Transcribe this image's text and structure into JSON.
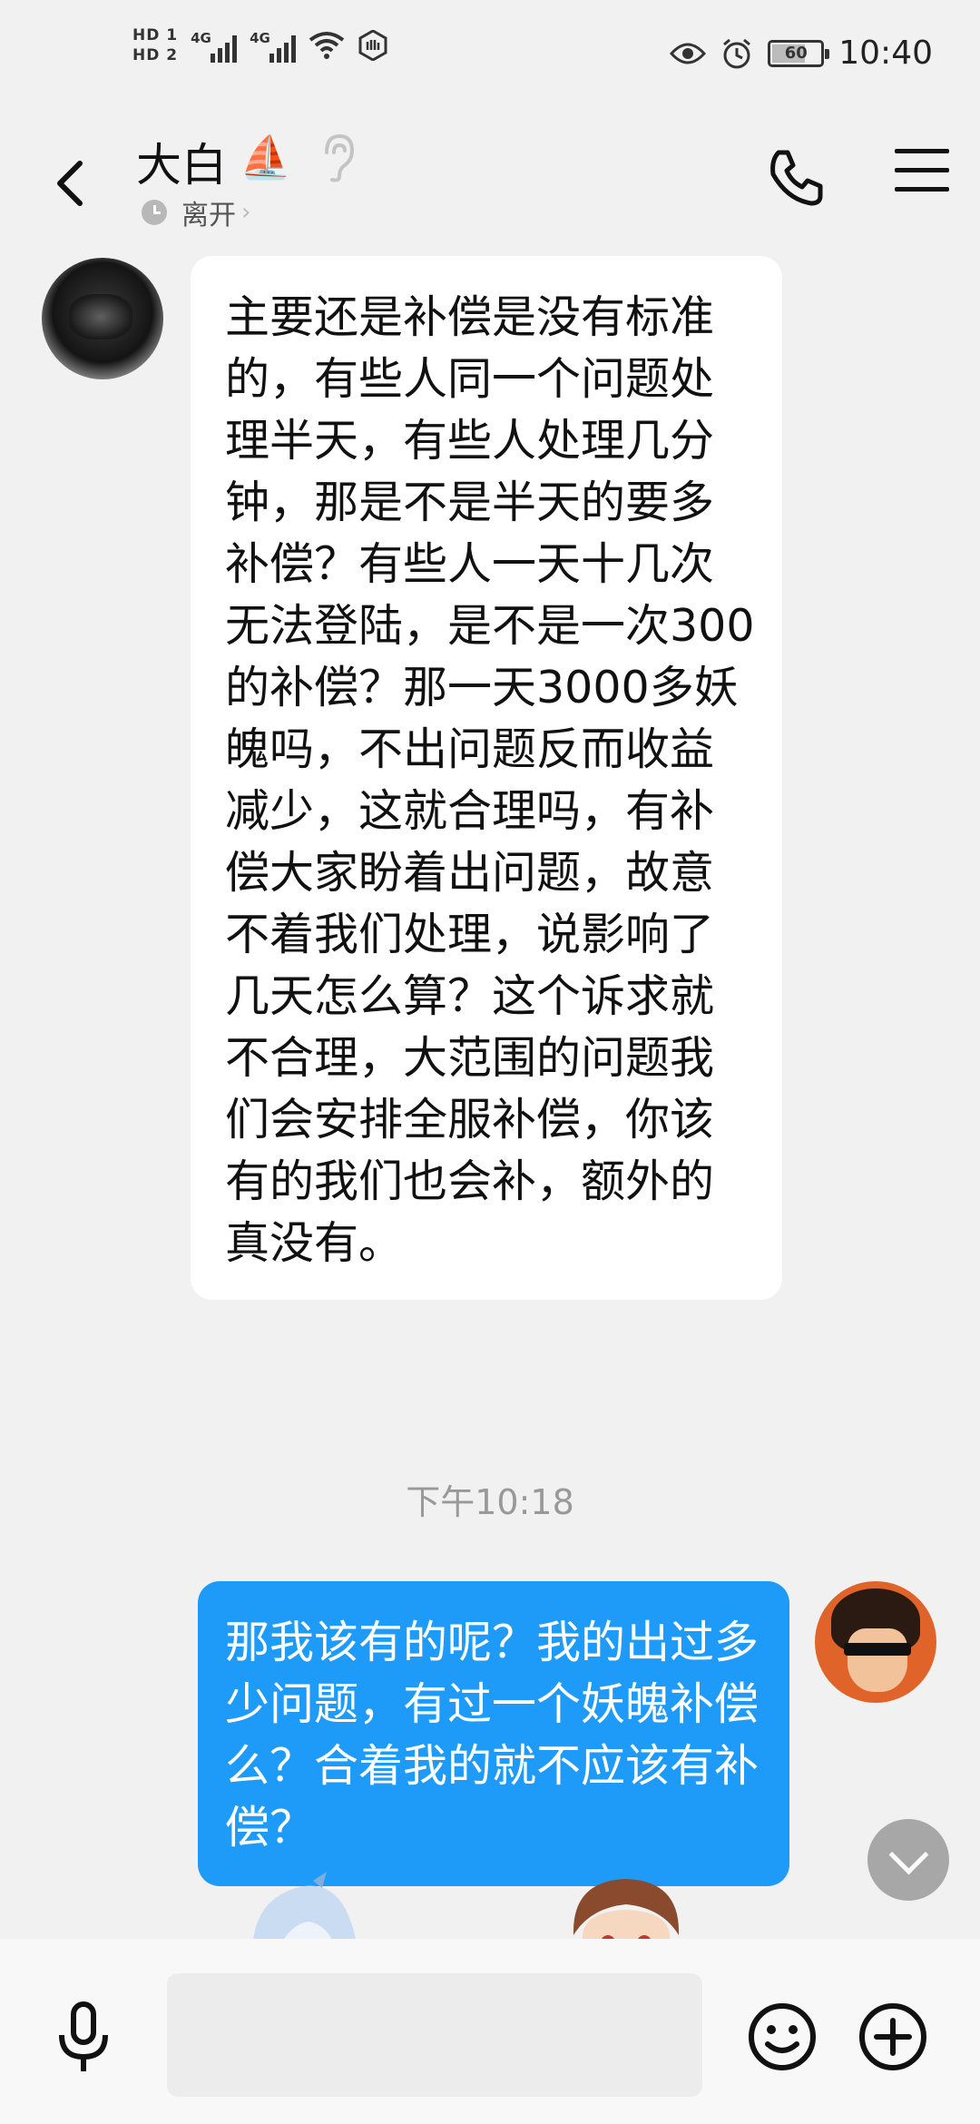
{
  "status_bar": {
    "hd1": "HD 1",
    "hd2": "HD 2",
    "net1": "4G",
    "net2": "4G",
    "battery": "60",
    "time": "10:40"
  },
  "header": {
    "contact_name": "大白",
    "name_emoji": "⛵",
    "status": "离开",
    "status_chevron": "›"
  },
  "messages": [
    {
      "direction": "incoming",
      "text": "主要还是补偿是没有标准的，有些人同一个问题处理半天，有些人处理几分钟，那是不是半天的要多补偿？有些人一天十几次无法登陆，是不是一次300的补偿？那一天3000多妖魄吗，不出问题反而收益减少，这就合理吗，有补偿大家盼着出问题，故意不着我们处理，说影响了几天怎么算？这个诉求就不合理，大范围的问题我们会安排全服补偿，你该有的我们也会补，额外的真没有。"
    },
    {
      "direction": "outgoing",
      "text": "那我该有的呢？我的出过多少问题，有过一个妖魄补偿么？合着我的就不应该有补偿？"
    }
  ],
  "timestamp": "下午10:18",
  "colors": {
    "background": "#f1f1f1",
    "incoming_bubble": "#ffffff",
    "outgoing_bubble": "#1e9bf9",
    "timestamp_text": "#999999"
  },
  "icons": {
    "back": "chevron-left-icon",
    "ear": "ear-icon",
    "phone": "phone-icon",
    "menu": "menu-icon",
    "mic": "microphone-icon",
    "emoji": "smiley-icon",
    "plus": "plus-circle-icon",
    "scroll": "chevron-down-icon"
  }
}
